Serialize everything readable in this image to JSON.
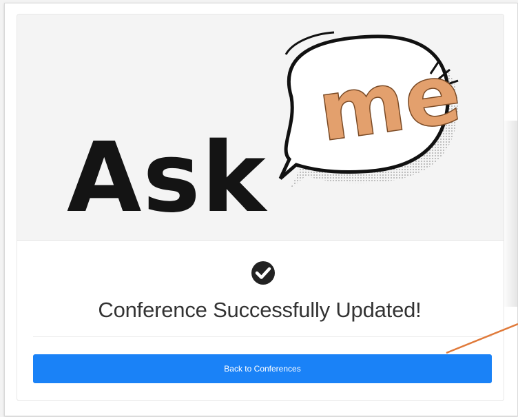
{
  "brand": {
    "logo_text_main": "Ask",
    "logo_text_bubble": "me",
    "colors": {
      "dark": "#141414",
      "bubble_letters": "#e3a06d"
    }
  },
  "status": {
    "icon": "check-circle-icon",
    "message": "Conference Successfully Updated!"
  },
  "actions": {
    "back_label": "Back to Conferences",
    "button_color": "#1a82f7"
  },
  "annotation": {
    "color": "#e07a3a"
  }
}
